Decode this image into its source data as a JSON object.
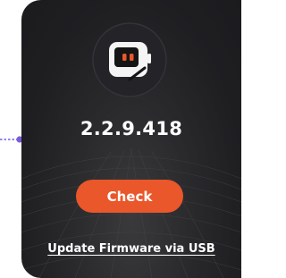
{
  "firmware": {
    "version": "2.2.9.418",
    "check_label": "Check",
    "usb_link_label": "Update Firmware via USB"
  },
  "icons": {
    "device": "robot-device-icon",
    "connector": "connector-dot-icon"
  },
  "colors": {
    "card_background": "#1f1f22",
    "accent": "#e9572a",
    "connector": "#7b5bd6",
    "text": "#ffffff"
  }
}
